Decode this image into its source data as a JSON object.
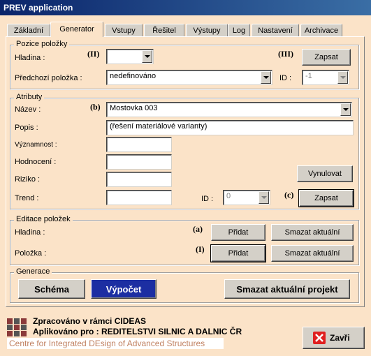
{
  "window": {
    "title": "PREV application"
  },
  "tabs": [
    {
      "label": "Základní"
    },
    {
      "label": "Generator",
      "active": true
    },
    {
      "label": "Vstupy"
    },
    {
      "label": "Řešitel"
    },
    {
      "label": "Výstupy"
    },
    {
      "label": "Log"
    },
    {
      "label": "Nastavení"
    },
    {
      "label": "Archivace"
    }
  ],
  "pozice": {
    "legend": "Pozice položky",
    "hladina_label": "Hladina :",
    "tag_ii": "(II)",
    "hladina_value": "",
    "tag_iii": "(III)",
    "zapsat_label": "Zapsat",
    "predchozi_label": "Předchozí položka :",
    "predchozi_value": "nedefinováno",
    "id_label": "ID :",
    "id_value": "-1"
  },
  "atributy": {
    "legend": "Atributy",
    "nazev_label": "Název :",
    "tag_b": "(b)",
    "nazev_value": "Mostovka 003",
    "popis_label": "Popis :",
    "popis_value": "(řešení materiálové varianty)",
    "vyznamnost_label": "Významnost :",
    "hodnoceni_label": "Hodnocení :",
    "riziko_label": "Riziko :",
    "trend_label": "Trend :",
    "vynulovat_label": "Vynulovat",
    "id_label": "ID :",
    "id_value": "0",
    "tag_c": "(c)",
    "zapsat_label": "Zapsat"
  },
  "editace": {
    "legend": "Editace položek",
    "hladina_label": "Hladina :",
    "tag_a": "(a)",
    "pridat_label": "Přidat",
    "smazat_label": "Smazat aktuální",
    "polozka_label": "Položka :",
    "tag_i": "(I)",
    "pridat2_label": "Přidat",
    "smazat2_label": "Smazat aktuální"
  },
  "generace": {
    "legend": "Generace",
    "schema_label": "Schéma",
    "vypocet_label": "Výpočet",
    "smazat_projekt_label": "Smazat aktuální projekt"
  },
  "footer": {
    "line1": "Zpracováno v rámci CIDEAS",
    "line2": "Aplikováno pro : REDITELSTVI SILNIC A DALNIC ČR",
    "logo_text": "Centre for Integrated DEsign of Advanced Structures",
    "zavri_label": "Zavři"
  },
  "colors": {
    "background": "#fbe3c8",
    "titlebar": "#0a246a",
    "vypocet_button": "#1c2ea2",
    "close_icon": "#e02020",
    "logo_text": "#c08060"
  }
}
